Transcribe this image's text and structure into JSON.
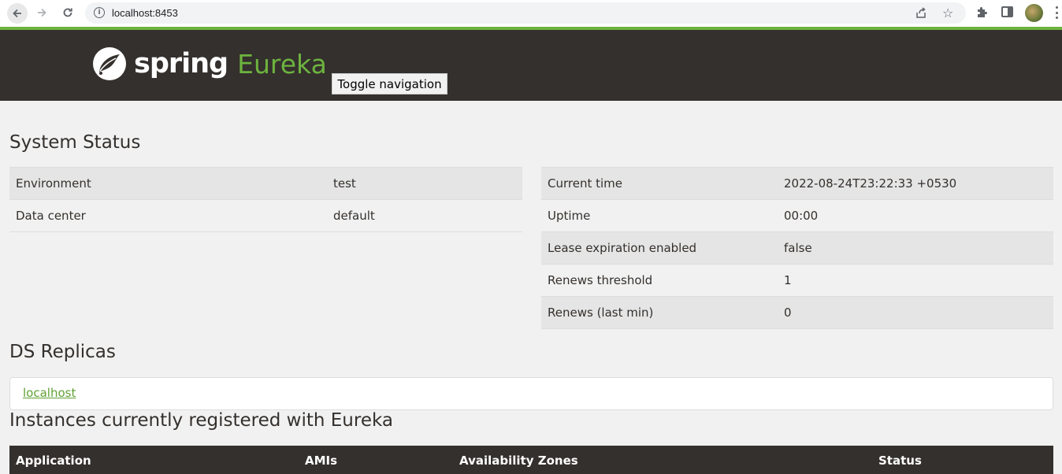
{
  "browser": {
    "url": "localhost:8453"
  },
  "header": {
    "logo_spring": "spring",
    "logo_eureka": "Eureka",
    "toggle_label": "Toggle navigation",
    "brand_color": "#6db33f",
    "bar_color": "#34302d"
  },
  "system_status": {
    "title": "System Status",
    "left": [
      {
        "key": "Environment",
        "value": "test"
      },
      {
        "key": "Data center",
        "value": "default"
      }
    ],
    "right": [
      {
        "key": "Current time",
        "value": "2022-08-24T23:22:33 +0530"
      },
      {
        "key": "Uptime",
        "value": "00:00"
      },
      {
        "key": "Lease expiration enabled",
        "value": "false"
      },
      {
        "key": "Renews threshold",
        "value": "1"
      },
      {
        "key": "Renews (last min)",
        "value": "0"
      }
    ]
  },
  "ds_replicas": {
    "title": "DS Replicas",
    "items": [
      "localhost"
    ]
  },
  "instances": {
    "title": "Instances currently registered with Eureka",
    "columns": [
      "Application",
      "AMIs",
      "Availability Zones",
      "Status"
    ]
  }
}
